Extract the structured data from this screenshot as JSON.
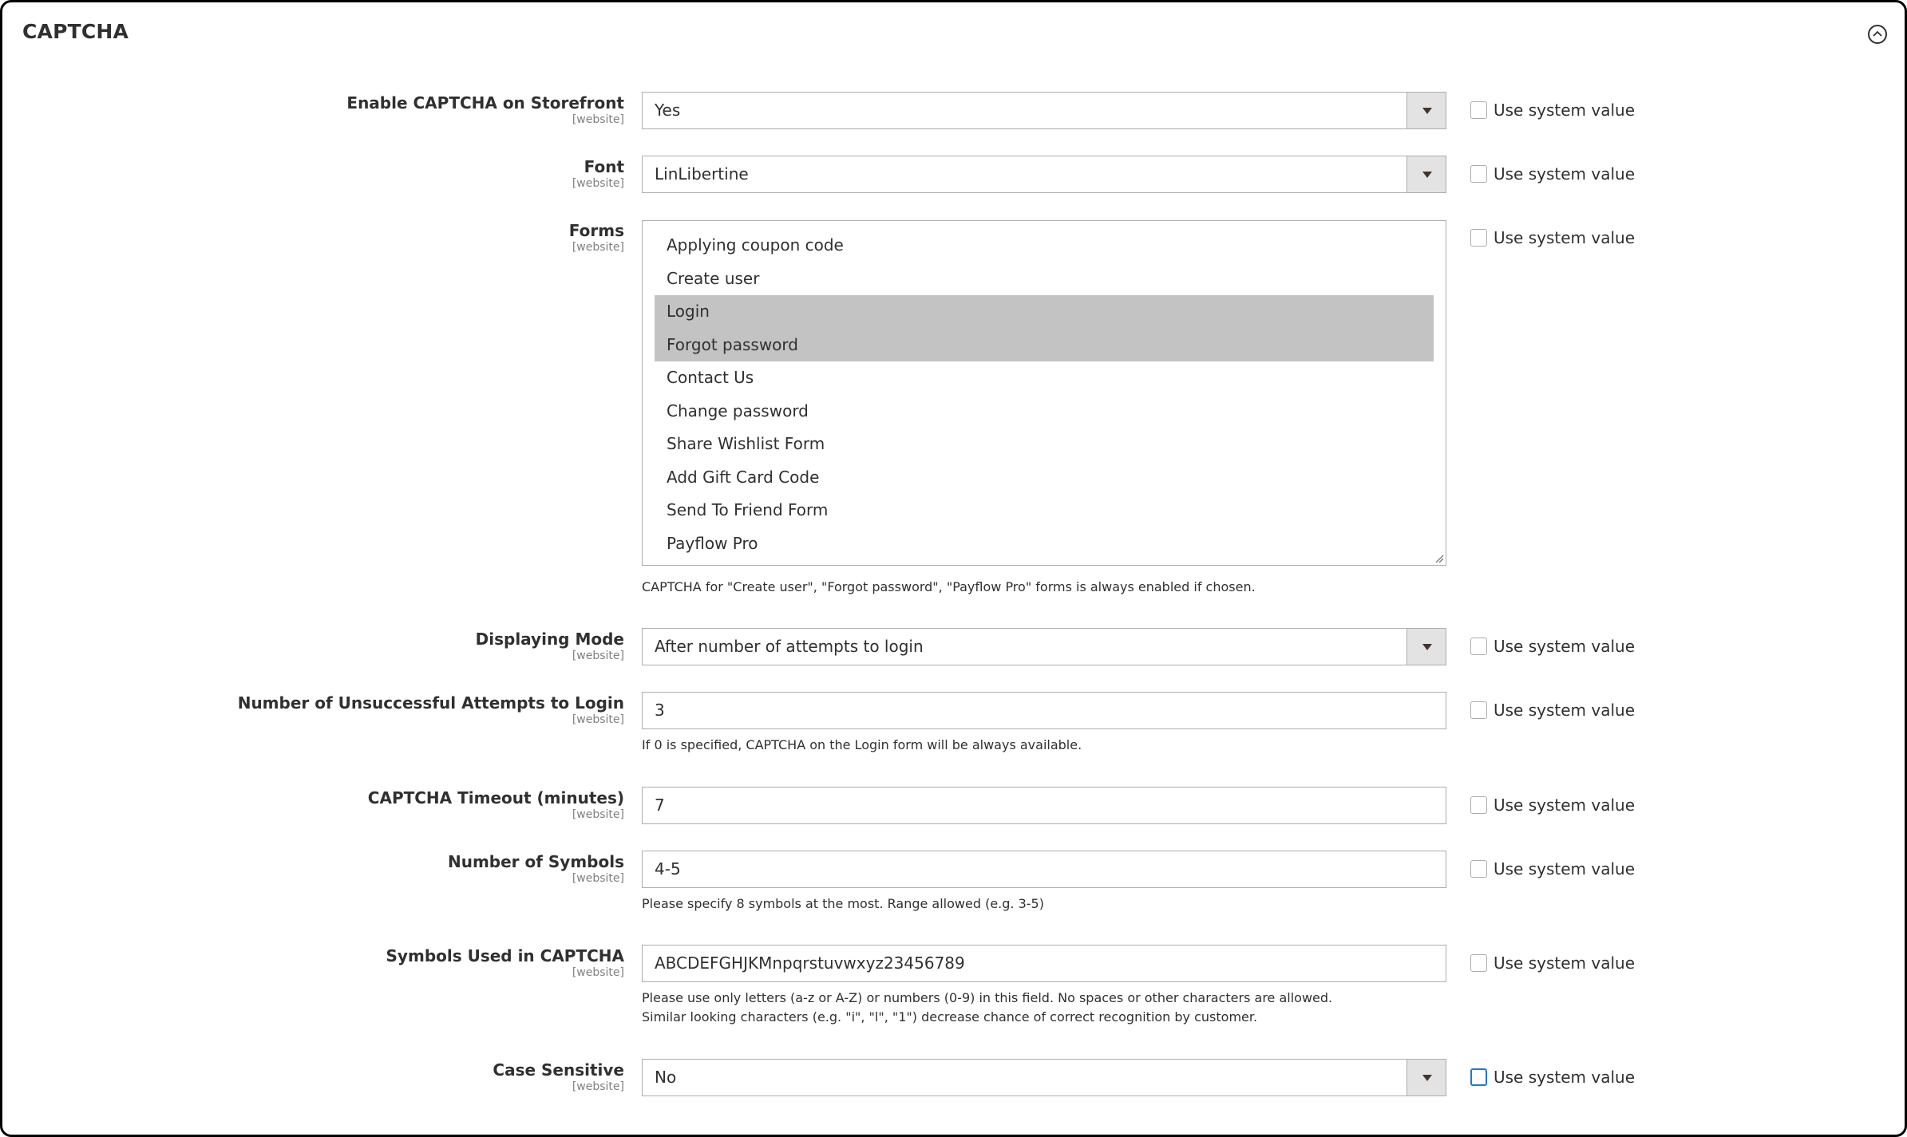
{
  "section": {
    "title": "CAPTCHA",
    "collapse_icon": "chevron-up-circle-icon"
  },
  "use_system_value_label": "Use system value",
  "fields": {
    "enable_storefront": {
      "label": "Enable CAPTCHA on Storefront",
      "scope": "[website]",
      "value": "Yes",
      "use_system_value": false
    },
    "font": {
      "label": "Font",
      "scope": "[website]",
      "value": "LinLibertine",
      "use_system_value": false
    },
    "forms": {
      "label": "Forms",
      "scope": "[website]",
      "options": [
        {
          "label": "Applying coupon code",
          "selected": false
        },
        {
          "label": "Create user",
          "selected": false
        },
        {
          "label": "Login",
          "selected": true
        },
        {
          "label": "Forgot password",
          "selected": true
        },
        {
          "label": "Contact Us",
          "selected": false
        },
        {
          "label": "Change password",
          "selected": false
        },
        {
          "label": "Share Wishlist Form",
          "selected": false
        },
        {
          "label": "Add Gift Card Code",
          "selected": false
        },
        {
          "label": "Send To Friend Form",
          "selected": false
        },
        {
          "label": "Payflow Pro",
          "selected": false
        }
      ],
      "note": "CAPTCHA for \"Create user\", \"Forgot password\", \"Payflow Pro\" forms is always enabled if chosen.",
      "use_system_value": false
    },
    "displaying_mode": {
      "label": "Displaying Mode",
      "scope": "[website]",
      "value": "After number of attempts to login",
      "use_system_value": false
    },
    "unsuccessful_attempts": {
      "label": "Number of Unsuccessful Attempts to Login",
      "scope": "[website]",
      "value": "3",
      "note": "If 0 is specified, CAPTCHA on the Login form will be always available.",
      "use_system_value": false
    },
    "timeout": {
      "label": "CAPTCHA Timeout (minutes)",
      "scope": "[website]",
      "value": "7",
      "use_system_value": false
    },
    "number_of_symbols": {
      "label": "Number of Symbols",
      "scope": "[website]",
      "value": "4-5",
      "note": "Please specify 8 symbols at the most. Range allowed (e.g. 3-5)",
      "use_system_value": false
    },
    "symbols_used": {
      "label": "Symbols Used in CAPTCHA",
      "scope": "[website]",
      "value": "ABCDEFGHJKMnpqrstuvwxyz23456789",
      "note_line1": "Please use only letters (a-z or A-Z) or numbers (0-9) in this field. No spaces or other characters are allowed.",
      "note_line2": "Similar looking characters (e.g. \"i\", \"l\", \"1\") decrease chance of correct recognition by customer.",
      "use_system_value": false
    },
    "case_sensitive": {
      "label": "Case Sensitive",
      "scope": "[website]",
      "value": "No",
      "use_system_value": false,
      "checkbox_focused": true
    }
  },
  "colors": {
    "selected_option_bg": "#c3c3c3",
    "focus_border": "#2176d6",
    "select_arrow_bg": "#e3e3e3",
    "text": "#303030",
    "scope_text": "#808080"
  }
}
